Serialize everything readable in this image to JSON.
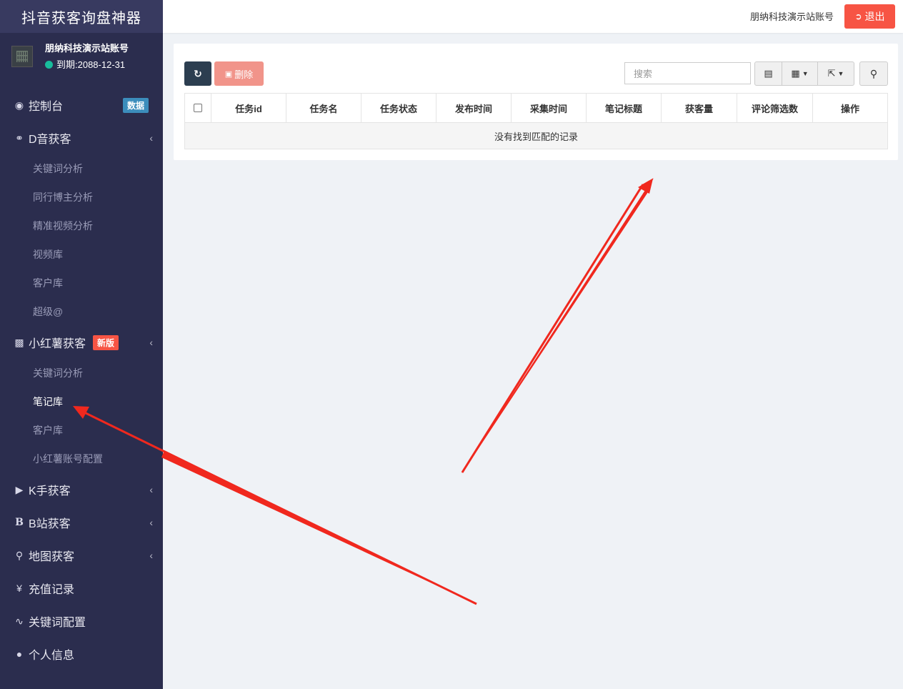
{
  "app": {
    "title": "抖音获客询盘神器"
  },
  "user": {
    "name": "朋纳科技演示站账号",
    "expiry": "到期:2088-12-31"
  },
  "sidebar": {
    "items": [
      {
        "label": "控制台",
        "icon": "dashboard-icon",
        "badge": "数据"
      },
      {
        "label": "D音获客",
        "icon": "handshake-icon"
      },
      {
        "label": "关键词分析"
      },
      {
        "label": "同行博主分析"
      },
      {
        "label": "精准视频分析"
      },
      {
        "label": "视频库"
      },
      {
        "label": "客户库"
      },
      {
        "label": "超级@"
      },
      {
        "label": "小红薯获客",
        "icon": "contact-card-icon",
        "badge": "新版"
      },
      {
        "label": "关键词分析"
      },
      {
        "label": "笔记库"
      },
      {
        "label": "客户库"
      },
      {
        "label": "小红薯账号配置"
      },
      {
        "label": "K手获客",
        "icon": "play-circle-icon"
      },
      {
        "label": "B站获客",
        "icon": "bold-b-icon"
      },
      {
        "label": "地图获客",
        "icon": "map-marker-icon"
      },
      {
        "label": "充值记录",
        "icon": "yen-icon"
      },
      {
        "label": "关键词配置",
        "icon": "rss-icon"
      },
      {
        "label": "个人信息",
        "icon": "user-icon"
      }
    ]
  },
  "header": {
    "account": "朋纳科技演示站账号",
    "logout_label": "退出"
  },
  "toolbar": {
    "delete_label": "删除",
    "search_placeholder": "搜索"
  },
  "table": {
    "columns": [
      "任务id",
      "任务名",
      "任务状态",
      "发布时间",
      "采集时间",
      "笔记标题",
      "获客量",
      "评论筛选数",
      "操作"
    ],
    "empty_text": "没有找到匹配的记录"
  },
  "colors": {
    "sidebar": "#2b2d4e",
    "logo_bg": "#383a60",
    "danger": "#f75444",
    "primary_dark": "#2c3e50",
    "accent_blue": "#3c8dbc",
    "annotation": "#f0281e"
  }
}
